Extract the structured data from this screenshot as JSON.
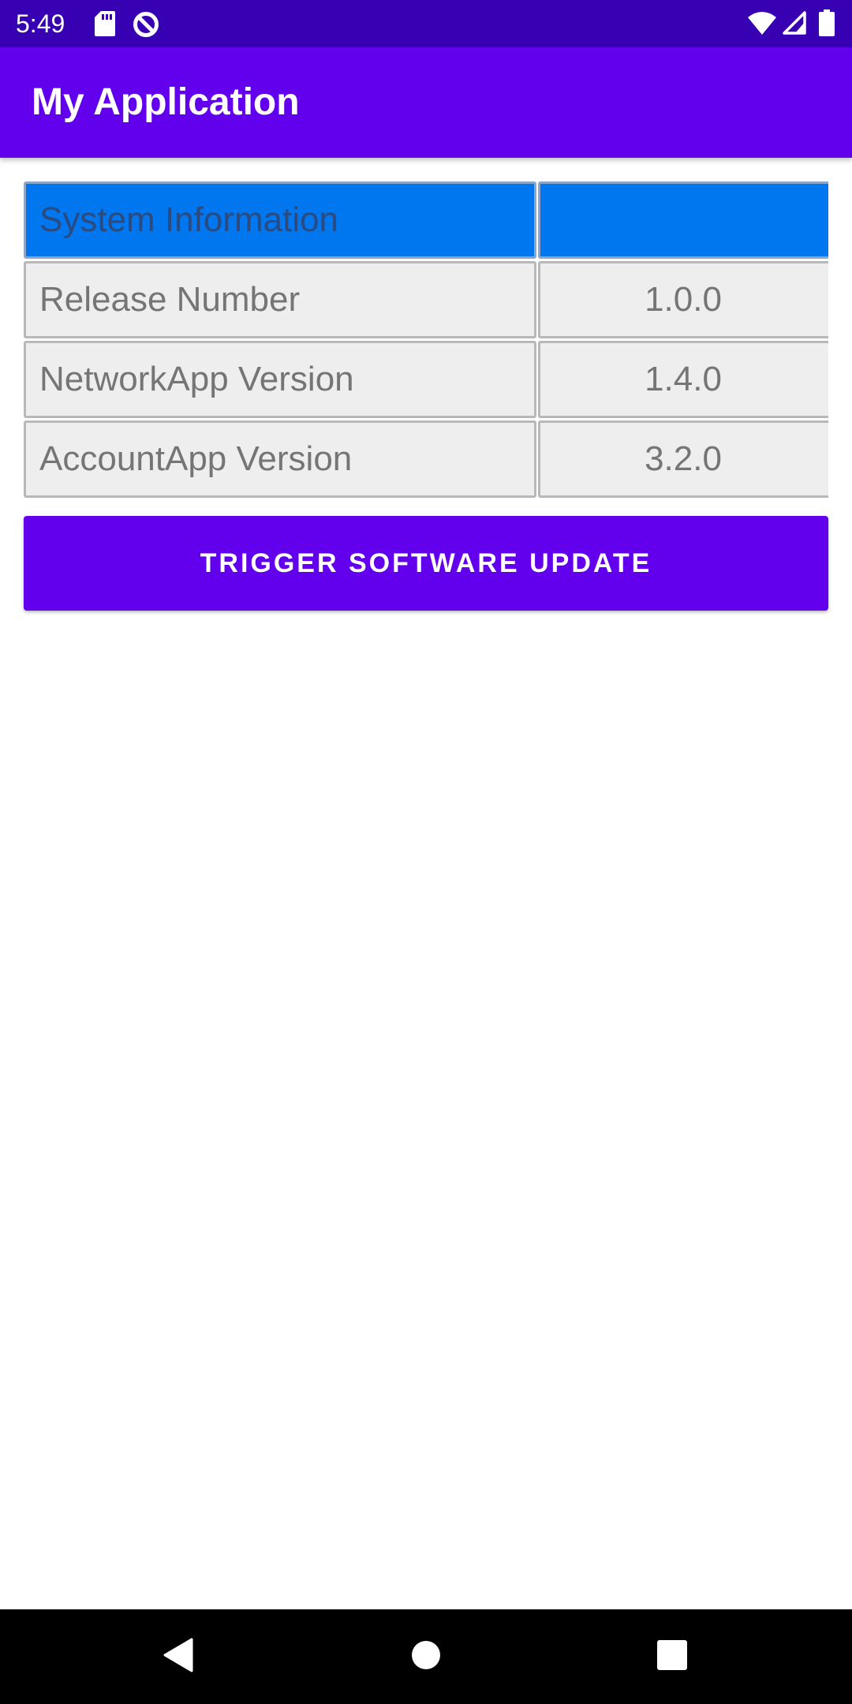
{
  "status_bar": {
    "time": "5:49",
    "left_icons": [
      "sd-card-icon",
      "data-saver-icon"
    ],
    "right_icons": [
      "wifi-icon",
      "cell-signal-icon",
      "battery-icon"
    ],
    "background": "#3700b3"
  },
  "app_bar": {
    "title": "My Application",
    "background": "#6200ee"
  },
  "system_table": {
    "header": {
      "label": "System Information",
      "value": ""
    },
    "rows": [
      {
        "label": "Release Number",
        "value": "1.0.0"
      },
      {
        "label": "NetworkApp Version",
        "value": "1.4.0"
      },
      {
        "label": "AccountApp Version",
        "value": "3.2.0"
      }
    ],
    "header_color": "#0077ee",
    "cell_color": "#eeeeee"
  },
  "update_button": {
    "label": "TRIGGER SOFTWARE UPDATE",
    "background": "#6200ee"
  },
  "nav_bar": {
    "buttons": [
      "back-icon",
      "home-icon",
      "recents-icon"
    ]
  }
}
